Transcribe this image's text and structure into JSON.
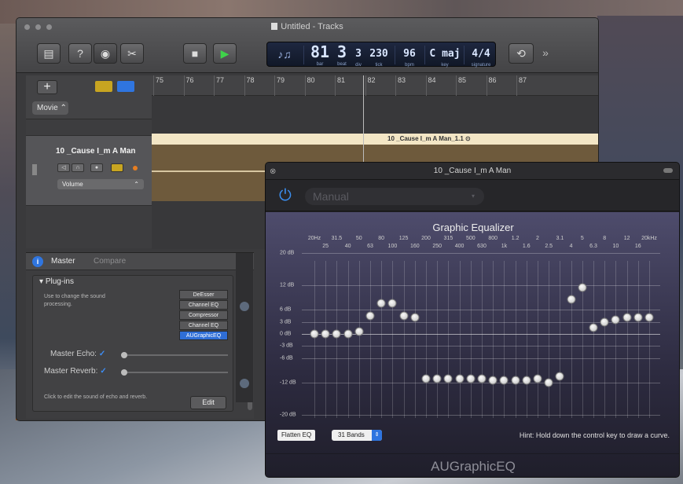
{
  "window": {
    "title": "Untitled - Tracks"
  },
  "lcd": {
    "bar": "81",
    "beat": "3",
    "div": "3",
    "tick": "230",
    "tempo": "96",
    "key": "C maj",
    "signature": "4/4",
    "labels": {
      "bar": "bar",
      "beat": "beat",
      "div": "div",
      "tick": "tick",
      "tempo": "bpm",
      "key": "key",
      "signature": "signature"
    }
  },
  "ruler": {
    "ticks": [
      "75",
      "76",
      "77",
      "78",
      "79",
      "80",
      "81",
      "82",
      "83",
      "84",
      "85",
      "86",
      "87"
    ]
  },
  "movie_label": "Movie",
  "track": {
    "name": "10 _Cause I_m A Man",
    "automation": "Volume",
    "region": "10 _Cause I_m A Man_1.1"
  },
  "inspector": {
    "tabs": [
      "Master",
      "Compare"
    ],
    "plugins_title": "Plug-ins",
    "plugins_desc": "Use to change the sound processing.",
    "plugins": [
      "DeEsser",
      "Channel EQ",
      "Compressor",
      "Channel EQ",
      "AUGraphicEQ"
    ],
    "master_echo": "Master Echo:",
    "master_reverb": "Master Reverb:",
    "click_desc": "Click to edit the sound of echo and reverb.",
    "edit": "Edit"
  },
  "eq": {
    "window_title": "10 _Cause I_m A Man",
    "preset": "Manual",
    "title": "Graphic Equalizer",
    "freq_top": [
      "20Hz",
      "31.5",
      "50",
      "80",
      "125",
      "200",
      "315",
      "500",
      "800",
      "1.2",
      "2",
      "3.1",
      "5",
      "8",
      "12",
      "20kHz"
    ],
    "freq_bottom": [
      "25",
      "40",
      "63",
      "100",
      "160",
      "250",
      "400",
      "630",
      "1k",
      "1.6",
      "2.5",
      "4",
      "6.3",
      "10",
      "16"
    ],
    "db_labels": [
      "20 dB",
      "12 dB",
      "6 dB",
      "3 dB",
      "0 dB",
      "-3 dB",
      "-6 dB",
      "-12 dB",
      "-20 dB"
    ],
    "band_values_db": [
      0,
      0,
      0,
      0,
      0.5,
      4.5,
      7.5,
      7.5,
      4.5,
      4,
      -11,
      -11,
      -11,
      -11,
      -11,
      -11,
      -11.5,
      -11.5,
      -11.5,
      -11.5,
      -11,
      -12,
      -10.5,
      8.5,
      11.5,
      1.5,
      3,
      3.5,
      4,
      4,
      4
    ],
    "flatten": "Flatten EQ",
    "bands": "31 Bands",
    "hint": "Hint: Hold down the control key to draw a curve.",
    "footer": "AUGraphicEQ"
  },
  "colors": {
    "accent": "#2f75df",
    "play": "#3fd34a",
    "region": "#f3e6c5"
  }
}
